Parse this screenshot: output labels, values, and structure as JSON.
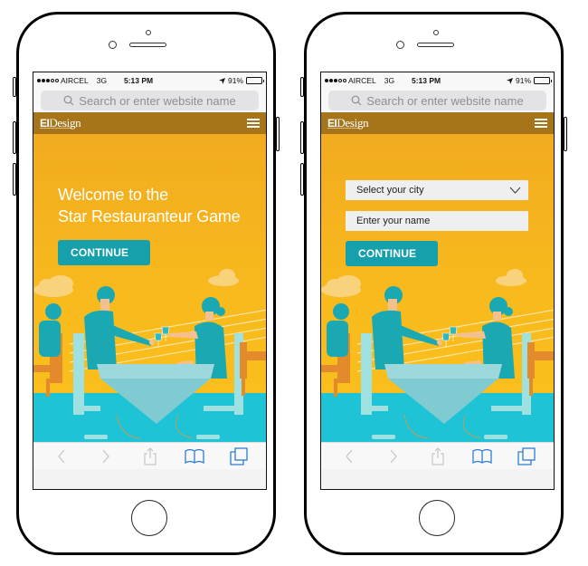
{
  "devices": [
    {
      "id": "left",
      "statusbar": {
        "carrier": "AIRCEL",
        "network": "3G",
        "time": "5:13 PM",
        "battery": "91%",
        "battery_level": 0.91,
        "signal_bars_filled": 3,
        "signal_bars_total": 5
      },
      "urlbar": {
        "placeholder": "Search or enter website name",
        "icon": "search-icon"
      },
      "site": {
        "logo_bold": "EI",
        "logo_rest": "Design",
        "menu_icon": "hamburger-icon"
      },
      "hero": {
        "welcome_line1": "Welcome to the",
        "welcome_line2": "Star Restauranteur Game",
        "continue_label": "CONTINUE"
      },
      "toolbar": {
        "back": "back-icon",
        "forward": "forward-icon",
        "share": "share-icon",
        "bookmarks": "bookmarks-icon",
        "tabs": "tabs-icon"
      }
    },
    {
      "id": "right",
      "statusbar": {
        "carrier": "AIRCEL",
        "network": "3G",
        "time": "5:13 PM",
        "battery": "91%",
        "battery_level": 0.91,
        "signal_bars_filled": 3,
        "signal_bars_total": 5
      },
      "urlbar": {
        "placeholder": "Search or enter website name",
        "icon": "search-icon"
      },
      "site": {
        "logo_bold": "EI",
        "logo_rest": "Design",
        "menu_icon": "hamburger-icon"
      },
      "form": {
        "city_select": {
          "selected": "Select your city"
        },
        "name_input": {
          "placeholder": "Enter your name",
          "value": ""
        },
        "continue_label": "CONTINUE"
      },
      "toolbar": {
        "back": "back-icon",
        "forward": "forward-icon",
        "share": "share-icon",
        "bookmarks": "bookmarks-icon",
        "tabs": "tabs-icon"
      }
    }
  ],
  "colors": {
    "header_brown": "#a67419",
    "hero_yellow": "#f7b81d",
    "accent_teal": "#15a0ab",
    "floor_cyan": "#1ec3d6",
    "ios_blue": "#2f7cd3"
  }
}
